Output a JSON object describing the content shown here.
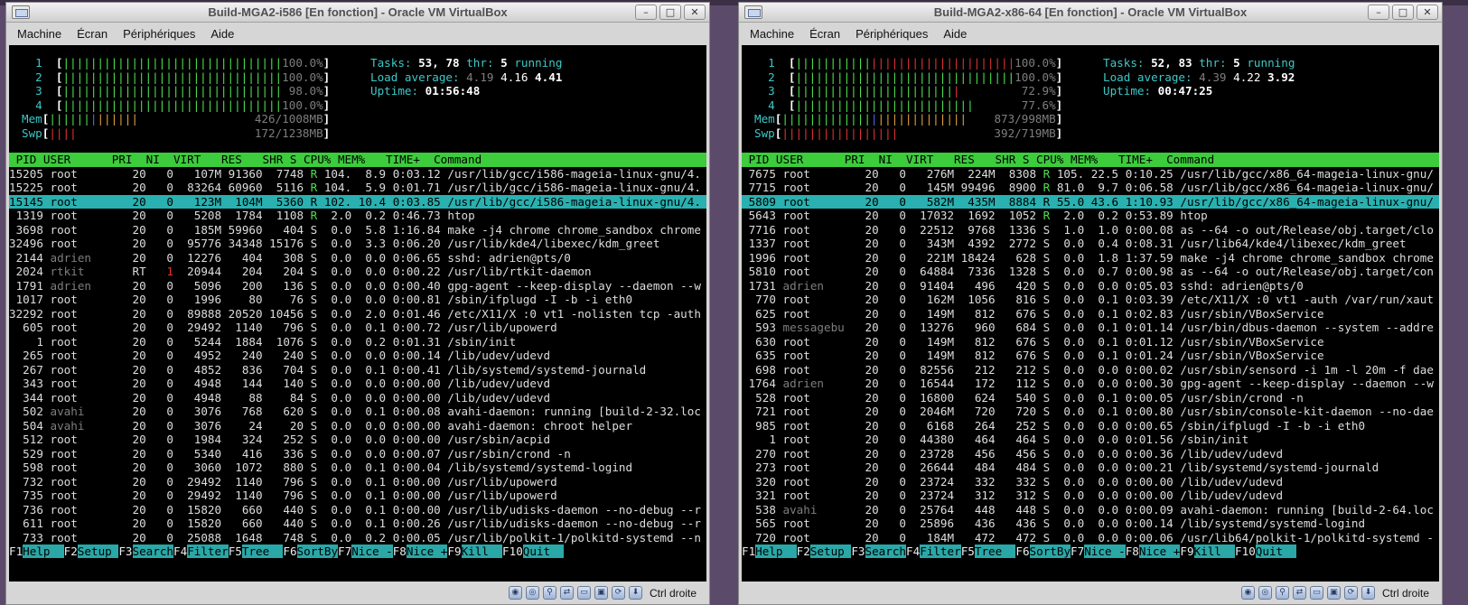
{
  "vm1": {
    "title": "Build-MGA2-i586 [En fonction] - Oracle VM VirtualBox",
    "menu": [
      "Machine",
      "Écran",
      "Périphériques",
      "Aide"
    ],
    "cpus": [
      {
        "num": "1",
        "pct": "100.0%"
      },
      {
        "num": "2",
        "pct": "100.0%"
      },
      {
        "num": "3",
        "pct": "98.0%"
      },
      {
        "num": "4",
        "pct": "100.0%"
      }
    ],
    "mem": {
      "label": "Mem",
      "value": "426/1008MB"
    },
    "swp": {
      "label": "Swp",
      "value": "172/1238MB"
    },
    "tasks": {
      "label": "Tasks:",
      "count": "53,",
      "thr": "78",
      "thr_label": "thr:",
      "running": "5",
      "running_label": "running"
    },
    "load": {
      "label": "Load average:",
      "l1": "4.19",
      "l5": "4.16",
      "l15": "4.41"
    },
    "uptime": {
      "label": "Uptime:",
      "value": "01:56:48"
    },
    "header": " PID USER      PRI  NI  VIRT   RES   SHR S CPU% MEM%   TIME+  Command",
    "rows": [
      {
        "pid": "15205",
        "user": "root",
        "pri": "20",
        "ni": "0",
        "virt": "107M",
        "res": "91360",
        "shr": "7748",
        "s": "R",
        "cpu": "104.",
        "mem": "8.9",
        "time": "0:03.12",
        "cmd": "/usr/lib/gcc/i586-mageia-linux-gnu/4."
      },
      {
        "pid": "15225",
        "user": "root",
        "pri": "20",
        "ni": "0",
        "virt": "83264",
        "res": "60960",
        "shr": "5116",
        "s": "R",
        "cpu": "104.",
        "mem": "5.9",
        "time": "0:01.71",
        "cmd": "/usr/lib/gcc/i586-mageia-linux-gnu/4."
      },
      {
        "pid": "15145",
        "user": "root",
        "pri": "20",
        "ni": "0",
        "virt": "123M",
        "res": "104M",
        "shr": "5360",
        "s": "R",
        "cpu": "102.",
        "mem": "10.4",
        "time": "0:03.85",
        "cmd": "/usr/lib/gcc/i586-mageia-linux-gnu/4.",
        "sel": true
      },
      {
        "pid": "1319",
        "user": "root",
        "pri": "20",
        "ni": "0",
        "virt": "5208",
        "res": "1784",
        "shr": "1108",
        "s": "R",
        "cpu": "2.0",
        "mem": "0.2",
        "time": "0:46.73",
        "cmd": "htop"
      },
      {
        "pid": "3698",
        "user": "root",
        "pri": "20",
        "ni": "0",
        "virt": "185M",
        "res": "59960",
        "shr": "404",
        "s": "S",
        "cpu": "0.0",
        "mem": "5.8",
        "time": "1:16.84",
        "cmd": "make -j4 chrome chrome_sandbox chrome"
      },
      {
        "pid": "32496",
        "user": "root",
        "pri": "20",
        "ni": "0",
        "virt": "95776",
        "res": "34348",
        "shr": "15176",
        "s": "S",
        "cpu": "0.0",
        "mem": "3.3",
        "time": "0:06.20",
        "cmd": "/usr/lib/kde4/libexec/kdm_greet"
      },
      {
        "pid": "2144",
        "user": "adrien",
        "pri": "20",
        "ni": "0",
        "virt": "12276",
        "res": "404",
        "shr": "308",
        "s": "S",
        "cpu": "0.0",
        "mem": "0.0",
        "time": "0:06.65",
        "cmd": "sshd: adrien@pts/0"
      },
      {
        "pid": "2024",
        "user": "rtkit",
        "pri": "RT",
        "ni": "1",
        "virt": "20944",
        "res": "204",
        "shr": "204",
        "s": "S",
        "cpu": "0.0",
        "mem": "0.0",
        "time": "0:00.22",
        "cmd": "/usr/lib/rtkit-daemon"
      },
      {
        "pid": "1791",
        "user": "adrien",
        "pri": "20",
        "ni": "0",
        "virt": "5096",
        "res": "200",
        "shr": "136",
        "s": "S",
        "cpu": "0.0",
        "mem": "0.0",
        "time": "0:00.40",
        "cmd": "gpg-agent --keep-display --daemon --w"
      },
      {
        "pid": "1017",
        "user": "root",
        "pri": "20",
        "ni": "0",
        "virt": "1996",
        "res": "80",
        "shr": "76",
        "s": "S",
        "cpu": "0.0",
        "mem": "0.0",
        "time": "0:00.81",
        "cmd": "/sbin/ifplugd -I -b -i eth0"
      },
      {
        "pid": "32292",
        "user": "root",
        "pri": "20",
        "ni": "0",
        "virt": "89888",
        "res": "20520",
        "shr": "10456",
        "s": "S",
        "cpu": "0.0",
        "mem": "2.0",
        "time": "0:01.46",
        "cmd": "/etc/X11/X :0 vt1 -nolisten tcp -auth"
      },
      {
        "pid": "605",
        "user": "root",
        "pri": "20",
        "ni": "0",
        "virt": "29492",
        "res": "1140",
        "shr": "796",
        "s": "S",
        "cpu": "0.0",
        "mem": "0.1",
        "time": "0:00.72",
        "cmd": "/usr/lib/upowerd"
      },
      {
        "pid": "1",
        "user": "root",
        "pri": "20",
        "ni": "0",
        "virt": "5244",
        "res": "1884",
        "shr": "1076",
        "s": "S",
        "cpu": "0.0",
        "mem": "0.2",
        "time": "0:01.31",
        "cmd": "/sbin/init"
      },
      {
        "pid": "265",
        "user": "root",
        "pri": "20",
        "ni": "0",
        "virt": "4952",
        "res": "240",
        "shr": "240",
        "s": "S",
        "cpu": "0.0",
        "mem": "0.0",
        "time": "0:00.14",
        "cmd": "/lib/udev/udevd"
      },
      {
        "pid": "267",
        "user": "root",
        "pri": "20",
        "ni": "0",
        "virt": "4852",
        "res": "836",
        "shr": "704",
        "s": "S",
        "cpu": "0.0",
        "mem": "0.1",
        "time": "0:00.41",
        "cmd": "/lib/systemd/systemd-journald"
      },
      {
        "pid": "343",
        "user": "root",
        "pri": "20",
        "ni": "0",
        "virt": "4948",
        "res": "144",
        "shr": "140",
        "s": "S",
        "cpu": "0.0",
        "mem": "0.0",
        "time": "0:00.00",
        "cmd": "/lib/udev/udevd"
      },
      {
        "pid": "344",
        "user": "root",
        "pri": "20",
        "ni": "0",
        "virt": "4948",
        "res": "88",
        "shr": "84",
        "s": "S",
        "cpu": "0.0",
        "mem": "0.0",
        "time": "0:00.00",
        "cmd": "/lib/udev/udevd"
      },
      {
        "pid": "502",
        "user": "avahi",
        "pri": "20",
        "ni": "0",
        "virt": "3076",
        "res": "768",
        "shr": "620",
        "s": "S",
        "cpu": "0.0",
        "mem": "0.1",
        "time": "0:00.08",
        "cmd": "avahi-daemon: running [build-2-32.loc"
      },
      {
        "pid": "504",
        "user": "avahi",
        "pri": "20",
        "ni": "0",
        "virt": "3076",
        "res": "24",
        "shr": "20",
        "s": "S",
        "cpu": "0.0",
        "mem": "0.0",
        "time": "0:00.00",
        "cmd": "avahi-daemon: chroot helper"
      },
      {
        "pid": "512",
        "user": "root",
        "pri": "20",
        "ni": "0",
        "virt": "1984",
        "res": "324",
        "shr": "252",
        "s": "S",
        "cpu": "0.0",
        "mem": "0.0",
        "time": "0:00.00",
        "cmd": "/usr/sbin/acpid"
      },
      {
        "pid": "529",
        "user": "root",
        "pri": "20",
        "ni": "0",
        "virt": "5340",
        "res": "416",
        "shr": "336",
        "s": "S",
        "cpu": "0.0",
        "mem": "0.0",
        "time": "0:00.07",
        "cmd": "/usr/sbin/crond -n"
      },
      {
        "pid": "598",
        "user": "root",
        "pri": "20",
        "ni": "0",
        "virt": "3060",
        "res": "1072",
        "shr": "880",
        "s": "S",
        "cpu": "0.0",
        "mem": "0.1",
        "time": "0:00.04",
        "cmd": "/lib/systemd/systemd-logind"
      },
      {
        "pid": "732",
        "user": "root",
        "pri": "20",
        "ni": "0",
        "virt": "29492",
        "res": "1140",
        "shr": "796",
        "s": "S",
        "cpu": "0.0",
        "mem": "0.1",
        "time": "0:00.00",
        "cmd": "/usr/lib/upowerd"
      },
      {
        "pid": "735",
        "user": "root",
        "pri": "20",
        "ni": "0",
        "virt": "29492",
        "res": "1140",
        "shr": "796",
        "s": "S",
        "cpu": "0.0",
        "mem": "0.1",
        "time": "0:00.00",
        "cmd": "/usr/lib/upowerd"
      },
      {
        "pid": "736",
        "user": "root",
        "pri": "20",
        "ni": "0",
        "virt": "15820",
        "res": "660",
        "shr": "440",
        "s": "S",
        "cpu": "0.0",
        "mem": "0.1",
        "time": "0:00.00",
        "cmd": "/usr/lib/udisks-daemon --no-debug --r"
      },
      {
        "pid": "611",
        "user": "root",
        "pri": "20",
        "ni": "0",
        "virt": "15820",
        "res": "660",
        "shr": "440",
        "s": "S",
        "cpu": "0.0",
        "mem": "0.1",
        "time": "0:00.26",
        "cmd": "/usr/lib/udisks-daemon --no-debug --r"
      },
      {
        "pid": "733",
        "user": "root",
        "pri": "20",
        "ni": "0",
        "virt": "25088",
        "res": "1648",
        "shr": "748",
        "s": "S",
        "cpu": "0.0",
        "mem": "0.2",
        "time": "0:00.05",
        "cmd": "/usr/lib/polkit-1/polkitd-systemd --n"
      }
    ],
    "hostkey": "Ctrl droite"
  },
  "vm2": {
    "title": "Build-MGA2-x86-64 [En fonction] - Oracle VM VirtualBox",
    "menu": [
      "Machine",
      "Écran",
      "Périphériques",
      "Aide"
    ],
    "cpus": [
      {
        "num": "1",
        "pct": "100.0%"
      },
      {
        "num": "2",
        "pct": "100.0%"
      },
      {
        "num": "3",
        "pct": "72.9%"
      },
      {
        "num": "4",
        "pct": "77.6%"
      }
    ],
    "mem": {
      "label": "Mem",
      "value": "873/998MB"
    },
    "swp": {
      "label": "Swp",
      "value": "392/719MB"
    },
    "tasks": {
      "label": "Tasks:",
      "count": "52,",
      "thr": "83",
      "thr_label": "thr:",
      "running": "5",
      "running_label": "running"
    },
    "load": {
      "label": "Load average:",
      "l1": "4.39",
      "l5": "4.22",
      "l15": "3.92"
    },
    "uptime": {
      "label": "Uptime:",
      "value": "00:47:25"
    },
    "header": " PID USER      PRI  NI  VIRT   RES   SHR S CPU% MEM%   TIME+  Command",
    "rows": [
      {
        "pid": "7675",
        "user": "root",
        "pri": "20",
        "ni": "0",
        "virt": "276M",
        "res": "224M",
        "shr": "8308",
        "s": "R",
        "cpu": "105.",
        "mem": "22.5",
        "time": "0:10.25",
        "cmd": "/usr/lib/gcc/x86_64-mageia-linux-gnu/"
      },
      {
        "pid": "7715",
        "user": "root",
        "pri": "20",
        "ni": "0",
        "virt": "145M",
        "res": "99496",
        "shr": "8900",
        "s": "R",
        "cpu": "81.0",
        "mem": "9.7",
        "time": "0:06.58",
        "cmd": "/usr/lib/gcc/x86_64-mageia-linux-gnu/"
      },
      {
        "pid": "5809",
        "user": "root",
        "pri": "20",
        "ni": "0",
        "virt": "582M",
        "res": "435M",
        "shr": "8884",
        "s": "R",
        "cpu": "55.0",
        "mem": "43.6",
        "time": "1:10.93",
        "cmd": "/usr/lib/gcc/x86_64-mageia-linux-gnu/",
        "sel": true
      },
      {
        "pid": "5643",
        "user": "root",
        "pri": "20",
        "ni": "0",
        "virt": "17032",
        "res": "1692",
        "shr": "1052",
        "s": "R",
        "cpu": "2.0",
        "mem": "0.2",
        "time": "0:53.89",
        "cmd": "htop"
      },
      {
        "pid": "7716",
        "user": "root",
        "pri": "20",
        "ni": "0",
        "virt": "22512",
        "res": "9768",
        "shr": "1336",
        "s": "S",
        "cpu": "1.0",
        "mem": "1.0",
        "time": "0:00.08",
        "cmd": "as --64 -o out/Release/obj.target/clo"
      },
      {
        "pid": "1337",
        "user": "root",
        "pri": "20",
        "ni": "0",
        "virt": "343M",
        "res": "4392",
        "shr": "2772",
        "s": "S",
        "cpu": "0.0",
        "mem": "0.4",
        "time": "0:08.31",
        "cmd": "/usr/lib64/kde4/libexec/kdm_greet"
      },
      {
        "pid": "1996",
        "user": "root",
        "pri": "20",
        "ni": "0",
        "virt": "221M",
        "res": "18424",
        "shr": "628",
        "s": "S",
        "cpu": "0.0",
        "mem": "1.8",
        "time": "1:37.59",
        "cmd": "make -j4 chrome chrome_sandbox chrome"
      },
      {
        "pid": "5810",
        "user": "root",
        "pri": "20",
        "ni": "0",
        "virt": "64884",
        "res": "7336",
        "shr": "1328",
        "s": "S",
        "cpu": "0.0",
        "mem": "0.7",
        "time": "0:00.98",
        "cmd": "as --64 -o out/Release/obj.target/con"
      },
      {
        "pid": "1731",
        "user": "adrien",
        "pri": "20",
        "ni": "0",
        "virt": "91404",
        "res": "496",
        "shr": "420",
        "s": "S",
        "cpu": "0.0",
        "mem": "0.0",
        "time": "0:05.03",
        "cmd": "sshd: adrien@pts/0"
      },
      {
        "pid": "770",
        "user": "root",
        "pri": "20",
        "ni": "0",
        "virt": "162M",
        "res": "1056",
        "shr": "816",
        "s": "S",
        "cpu": "0.0",
        "mem": "0.1",
        "time": "0:03.39",
        "cmd": "/etc/X11/X :0 vt1 -auth /var/run/xaut"
      },
      {
        "pid": "625",
        "user": "root",
        "pri": "20",
        "ni": "0",
        "virt": "149M",
        "res": "812",
        "shr": "676",
        "s": "S",
        "cpu": "0.0",
        "mem": "0.1",
        "time": "0:02.83",
        "cmd": "/usr/sbin/VBoxService"
      },
      {
        "pid": "593",
        "user": "messagebu",
        "pri": "20",
        "ni": "0",
        "virt": "13276",
        "res": "960",
        "shr": "684",
        "s": "S",
        "cpu": "0.0",
        "mem": "0.1",
        "time": "0:01.14",
        "cmd": "/usr/bin/dbus-daemon --system --addre"
      },
      {
        "pid": "630",
        "user": "root",
        "pri": "20",
        "ni": "0",
        "virt": "149M",
        "res": "812",
        "shr": "676",
        "s": "S",
        "cpu": "0.0",
        "mem": "0.1",
        "time": "0:01.12",
        "cmd": "/usr/sbin/VBoxService"
      },
      {
        "pid": "635",
        "user": "root",
        "pri": "20",
        "ni": "0",
        "virt": "149M",
        "res": "812",
        "shr": "676",
        "s": "S",
        "cpu": "0.0",
        "mem": "0.1",
        "time": "0:01.24",
        "cmd": "/usr/sbin/VBoxService"
      },
      {
        "pid": "698",
        "user": "root",
        "pri": "20",
        "ni": "0",
        "virt": "82556",
        "res": "212",
        "shr": "212",
        "s": "S",
        "cpu": "0.0",
        "mem": "0.0",
        "time": "0:00.02",
        "cmd": "/usr/sbin/sensord -i 1m -l 20m -f dae"
      },
      {
        "pid": "1764",
        "user": "adrien",
        "pri": "20",
        "ni": "0",
        "virt": "16544",
        "res": "172",
        "shr": "112",
        "s": "S",
        "cpu": "0.0",
        "mem": "0.0",
        "time": "0:00.30",
        "cmd": "gpg-agent --keep-display --daemon --w"
      },
      {
        "pid": "528",
        "user": "root",
        "pri": "20",
        "ni": "0",
        "virt": "16800",
        "res": "624",
        "shr": "540",
        "s": "S",
        "cpu": "0.0",
        "mem": "0.1",
        "time": "0:00.05",
        "cmd": "/usr/sbin/crond -n"
      },
      {
        "pid": "721",
        "user": "root",
        "pri": "20",
        "ni": "0",
        "virt": "2046M",
        "res": "720",
        "shr": "720",
        "s": "S",
        "cpu": "0.0",
        "mem": "0.1",
        "time": "0:00.80",
        "cmd": "/usr/sbin/console-kit-daemon --no-dae"
      },
      {
        "pid": "985",
        "user": "root",
        "pri": "20",
        "ni": "0",
        "virt": "6168",
        "res": "264",
        "shr": "252",
        "s": "S",
        "cpu": "0.0",
        "mem": "0.0",
        "time": "0:00.65",
        "cmd": "/sbin/ifplugd -I -b -i eth0"
      },
      {
        "pid": "1",
        "user": "root",
        "pri": "20",
        "ni": "0",
        "virt": "44380",
        "res": "464",
        "shr": "464",
        "s": "S",
        "cpu": "0.0",
        "mem": "0.0",
        "time": "0:01.56",
        "cmd": "/sbin/init"
      },
      {
        "pid": "270",
        "user": "root",
        "pri": "20",
        "ni": "0",
        "virt": "23728",
        "res": "456",
        "shr": "456",
        "s": "S",
        "cpu": "0.0",
        "mem": "0.0",
        "time": "0:00.36",
        "cmd": "/lib/udev/udevd"
      },
      {
        "pid": "273",
        "user": "root",
        "pri": "20",
        "ni": "0",
        "virt": "26644",
        "res": "484",
        "shr": "484",
        "s": "S",
        "cpu": "0.0",
        "mem": "0.0",
        "time": "0:00.21",
        "cmd": "/lib/systemd/systemd-journald"
      },
      {
        "pid": "320",
        "user": "root",
        "pri": "20",
        "ni": "0",
        "virt": "23724",
        "res": "332",
        "shr": "332",
        "s": "S",
        "cpu": "0.0",
        "mem": "0.0",
        "time": "0:00.00",
        "cmd": "/lib/udev/udevd"
      },
      {
        "pid": "321",
        "user": "root",
        "pri": "20",
        "ni": "0",
        "virt": "23724",
        "res": "312",
        "shr": "312",
        "s": "S",
        "cpu": "0.0",
        "mem": "0.0",
        "time": "0:00.00",
        "cmd": "/lib/udev/udevd"
      },
      {
        "pid": "538",
        "user": "avahi",
        "pri": "20",
        "ni": "0",
        "virt": "25764",
        "res": "448",
        "shr": "448",
        "s": "S",
        "cpu": "0.0",
        "mem": "0.0",
        "time": "0:00.09",
        "cmd": "avahi-daemon: running [build-2-64.loc"
      },
      {
        "pid": "565",
        "user": "root",
        "pri": "20",
        "ni": "0",
        "virt": "25896",
        "res": "436",
        "shr": "436",
        "s": "S",
        "cpu": "0.0",
        "mem": "0.0",
        "time": "0:00.14",
        "cmd": "/lib/systemd/systemd-logind"
      },
      {
        "pid": "720",
        "user": "root",
        "pri": "20",
        "ni": "0",
        "virt": "184M",
        "res": "472",
        "shr": "472",
        "s": "S",
        "cpu": "0.0",
        "mem": "0.0",
        "time": "0:00.06",
        "cmd": "/usr/lib64/polkit-1/polkitd-systemd -"
      }
    ],
    "hostkey": "Ctrl droite"
  },
  "footer": [
    {
      "key": "F1",
      "label": "Help  "
    },
    {
      "key": "F2",
      "label": "Setup "
    },
    {
      "key": "F3",
      "label": "Search"
    },
    {
      "key": "F4",
      "label": "Filter"
    },
    {
      "key": "F5",
      "label": "Tree  "
    },
    {
      "key": "F6",
      "label": "SortBy"
    },
    {
      "key": "F7",
      "label": "Nice -"
    },
    {
      "key": "F8",
      "label": "Nice +"
    },
    {
      "key": "F9",
      "label": "Kill  "
    },
    {
      "key": "F10",
      "label": "Quit  "
    }
  ],
  "window_buttons": {
    "minimize": "–",
    "maximize": "□",
    "close": "✕"
  },
  "colors": {
    "header_bg": "#3ccc3c",
    "selected_row": "#2ab0b0",
    "bar_green": "#4ce04c",
    "bar_red": "#e03434",
    "info_cyan": "#3ec8c8"
  }
}
